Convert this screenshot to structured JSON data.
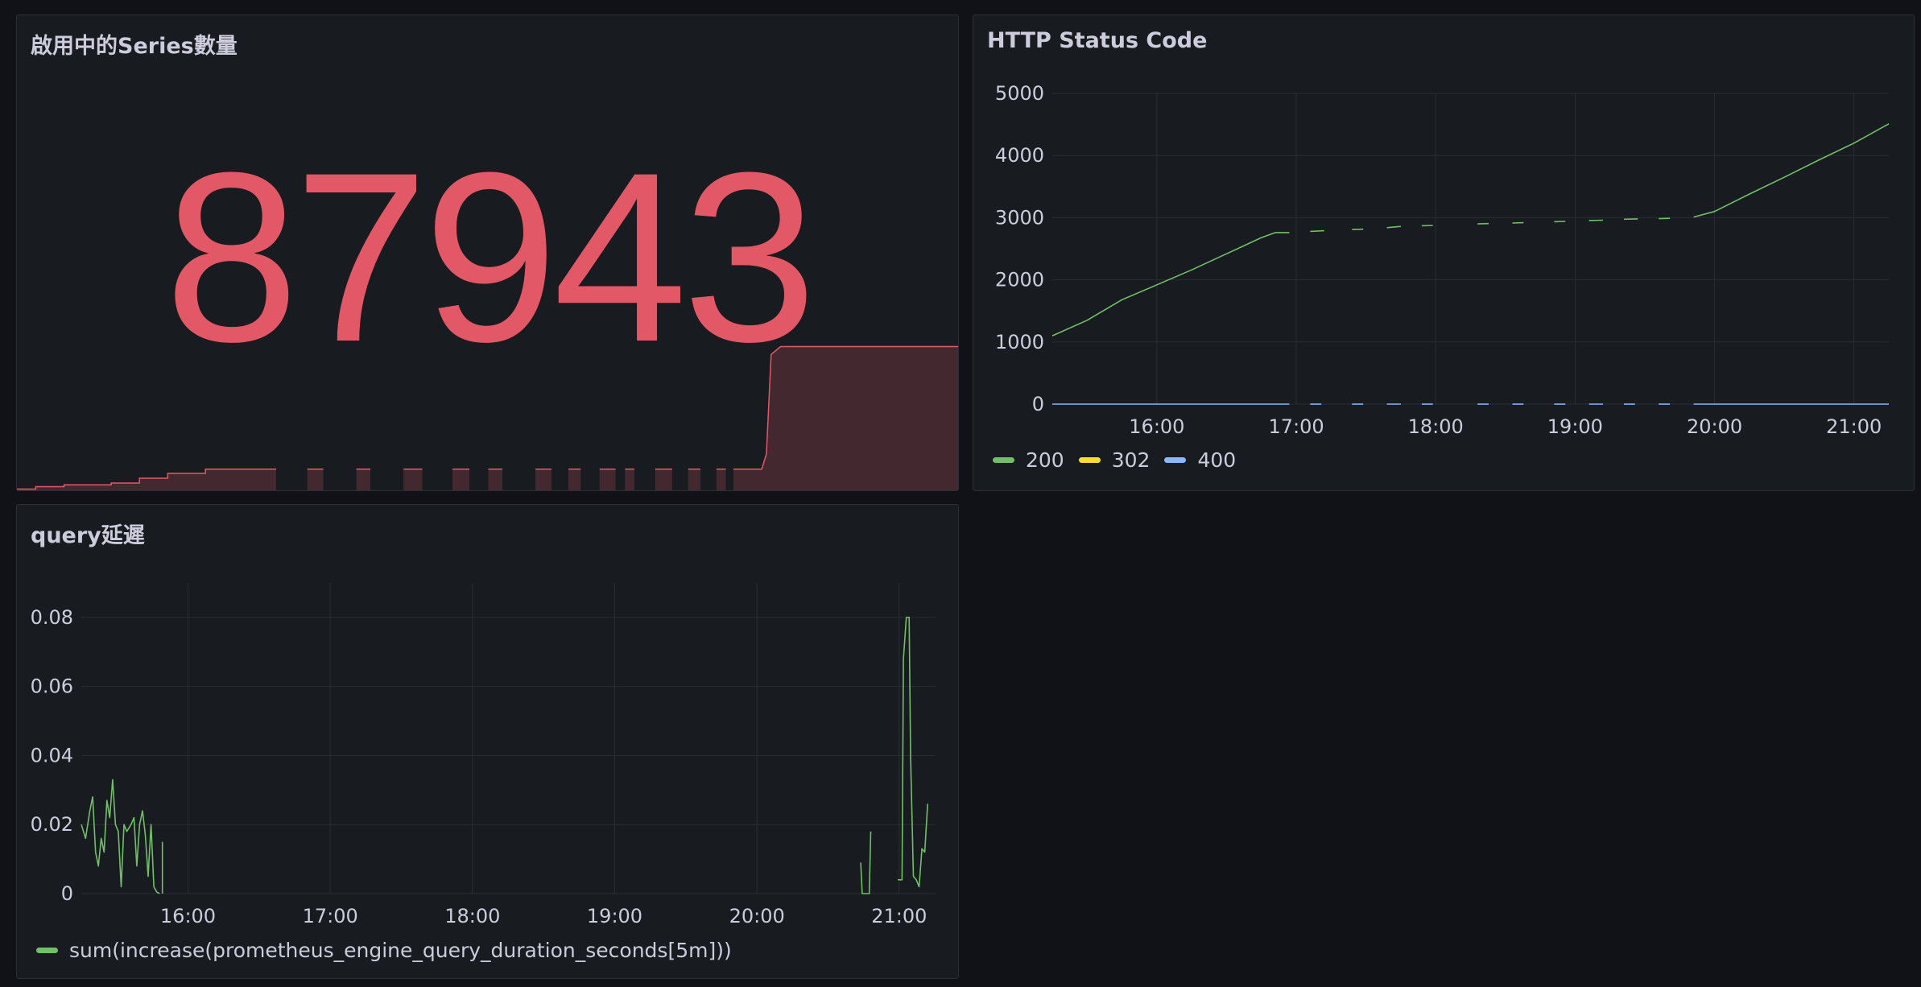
{
  "panels": {
    "series": {
      "title": "啟用中的Series數量",
      "value": "87943",
      "color": "#e35867",
      "sparkline": [
        [
          0,
          0.02
        ],
        [
          0.02,
          0.02
        ],
        [
          0.02,
          0.06
        ],
        [
          0.05,
          0.06
        ],
        [
          0.05,
          0.09
        ],
        [
          0.1,
          0.09
        ],
        [
          0.1,
          0.12
        ],
        [
          0.13,
          0.12
        ],
        [
          0.13,
          0.2
        ],
        [
          0.16,
          0.2
        ],
        [
          0.16,
          0.28
        ],
        [
          0.2,
          0.28
        ],
        [
          0.2,
          0.35
        ],
        [
          0.27,
          0.35
        ],
        [
          0.315,
          0.35
        ],
        [
          0.315,
          0.35
        ],
        [
          0.772,
          0.35
        ],
        [
          0.79,
          0.35
        ],
        [
          0.795,
          0.6
        ],
        [
          0.8,
          2.25
        ],
        [
          0.81,
          2.38
        ],
        [
          1,
          2.38
        ]
      ],
      "sparkline_gaps": [
        [
          0.275,
          0.308
        ],
        [
          0.325,
          0.36
        ],
        [
          0.375,
          0.41
        ],
        [
          0.43,
          0.462
        ],
        [
          0.48,
          0.5
        ],
        [
          0.515,
          0.55
        ],
        [
          0.567,
          0.585
        ],
        [
          0.598,
          0.618
        ],
        [
          0.635,
          0.645
        ],
        [
          0.655,
          0.677
        ],
        [
          0.695,
          0.712
        ],
        [
          0.725,
          0.742
        ],
        [
          0.752,
          0.76
        ]
      ]
    },
    "http": {
      "title": "HTTP Status Code",
      "chart_data": {
        "type": "line",
        "x_axis": {
          "ticks": [
            "16:00",
            "17:00",
            "18:00",
            "19:00",
            "20:00",
            "21:00"
          ],
          "tick_positions_hours": [
            16,
            17,
            18,
            19,
            20,
            21
          ],
          "range_hours": [
            15.25,
            21.25
          ]
        },
        "y_axis": {
          "ticks": [
            "0",
            "1000",
            "2000",
            "3000",
            "4000",
            "5000"
          ],
          "ylim": [
            0,
            5000
          ]
        },
        "series": [
          {
            "name": "200",
            "color": "#73bf69",
            "segments": [
              [
                [
                  15.25,
                  1100
                ],
                [
                  15.5,
                  1350
                ],
                [
                  15.75,
                  1680
                ],
                [
                  16.0,
                  1920
                ],
                [
                  16.25,
                  2160
                ],
                [
                  16.5,
                  2420
                ],
                [
                  16.75,
                  2680
                ],
                [
                  16.85,
                  2760
                ],
                [
                  16.95,
                  2760
                ]
              ],
              [
                [
                  17.1,
                  2780
                ],
                [
                  17.2,
                  2790
                ]
              ],
              [
                [
                  17.4,
                  2810
                ],
                [
                  17.48,
                  2815
                ]
              ],
              [
                [
                  17.65,
                  2840
                ],
                [
                  17.75,
                  2860
                ]
              ],
              [
                [
                  17.9,
                  2870
                ],
                [
                  17.98,
                  2875
                ]
              ],
              [
                [
                  18.3,
                  2900
                ],
                [
                  18.38,
                  2905
                ]
              ],
              [
                [
                  18.55,
                  2915
                ],
                [
                  18.63,
                  2920
                ]
              ],
              [
                [
                  18.85,
                  2935
                ],
                [
                  18.93,
                  2940
                ]
              ],
              [
                [
                  19.1,
                  2955
                ],
                [
                  19.2,
                  2960
                ]
              ],
              [
                [
                  19.35,
                  2975
                ],
                [
                  19.45,
                  2980
                ]
              ],
              [
                [
                  19.6,
                  2985
                ],
                [
                  19.68,
                  2990
                ]
              ],
              [
                [
                  19.85,
                  3010
                ],
                [
                  20.0,
                  3100
                ],
                [
                  20.25,
                  3380
                ],
                [
                  20.5,
                  3650
                ],
                [
                  20.75,
                  3930
                ],
                [
                  21.0,
                  4200
                ],
                [
                  21.25,
                  4510
                ]
              ]
            ]
          },
          {
            "name": "302",
            "color": "#fade2a",
            "segments": []
          },
          {
            "name": "400",
            "color": "#8ab8ff",
            "segments": [
              [
                [
                  15.25,
                  0
                ],
                [
                  16.95,
                  0
                ]
              ],
              [
                [
                  17.1,
                  0
                ],
                [
                  17.18,
                  0
                ]
              ],
              [
                [
                  17.4,
                  0
                ],
                [
                  17.48,
                  0
                ]
              ],
              [
                [
                  17.65,
                  0
                ],
                [
                  17.75,
                  0
                ]
              ],
              [
                [
                  17.9,
                  0
                ],
                [
                  17.98,
                  0
                ]
              ],
              [
                [
                  18.3,
                  0
                ],
                [
                  18.38,
                  0
                ]
              ],
              [
                [
                  18.55,
                  0
                ],
                [
                  18.63,
                  0
                ]
              ],
              [
                [
                  18.85,
                  0
                ],
                [
                  18.93,
                  0
                ]
              ],
              [
                [
                  19.1,
                  0
                ],
                [
                  19.2,
                  0
                ]
              ],
              [
                [
                  19.35,
                  0
                ],
                [
                  19.43,
                  0
                ]
              ],
              [
                [
                  19.6,
                  0
                ],
                [
                  19.68,
                  0
                ]
              ],
              [
                [
                  19.85,
                  0
                ],
                [
                  21.25,
                  0
                ]
              ]
            ]
          }
        ]
      }
    },
    "query": {
      "title": "query延遲",
      "chart_data": {
        "type": "line",
        "x_axis": {
          "ticks": [
            "16:00",
            "17:00",
            "18:00",
            "19:00",
            "20:00",
            "21:00"
          ],
          "tick_positions_hours": [
            16,
            17,
            18,
            19,
            20,
            21
          ],
          "range_hours": [
            15.25,
            21.25
          ]
        },
        "y_axis": {
          "ticks": [
            "0",
            "0.02",
            "0.04",
            "0.06",
            "0.08"
          ],
          "ylim": [
            0,
            0.09
          ]
        },
        "series": [
          {
            "name": "sum(increase(prometheus_engine_query_duration_seconds[5m]))",
            "color": "#73bf69",
            "segments": [
              [
                [
                  15.25,
                  0.02
                ],
                [
                  15.28,
                  0.016
                ],
                [
                  15.31,
                  0.024
                ],
                [
                  15.33,
                  0.028
                ],
                [
                  15.35,
                  0.012
                ],
                [
                  15.37,
                  0.008
                ],
                [
                  15.39,
                  0.016
                ],
                [
                  15.41,
                  0.012
                ],
                [
                  15.43,
                  0.027
                ],
                [
                  15.45,
                  0.022
                ],
                [
                  15.47,
                  0.033
                ],
                [
                  15.49,
                  0.02
                ],
                [
                  15.51,
                  0.018
                ],
                [
                  15.53,
                  0.002
                ],
                [
                  15.55,
                  0.02
                ],
                [
                  15.57,
                  0.018
                ],
                [
                  15.6,
                  0.02
                ],
                [
                  15.62,
                  0.022
                ],
                [
                  15.64,
                  0.008
                ],
                [
                  15.66,
                  0.02
                ],
                [
                  15.68,
                  0.024
                ],
                [
                  15.7,
                  0.017
                ],
                [
                  15.72,
                  0.005
                ],
                [
                  15.74,
                  0.02
                ],
                [
                  15.76,
                  0.002
                ],
                [
                  15.78,
                  0.0005
                ],
                [
                  15.8,
                  0.0
                ],
                [
                  15.8,
                  0.0
                ]
              ],
              [
                [
                  15.82,
                  0.0
                ],
                [
                  15.82,
                  0.015
                ]
              ],
              [
                [
                  20.73,
                  0.009
                ],
                [
                  20.74,
                  0.0
                ],
                [
                  20.79,
                  0.0
                ],
                [
                  20.8,
                  0.018
                ]
              ],
              [
                [
                  20.99,
                  0.004
                ],
                [
                  21.02,
                  0.004
                ],
                [
                  21.03,
                  0.068
                ],
                [
                  21.05,
                  0.08
                ],
                [
                  21.07,
                  0.08
                ],
                [
                  21.08,
                  0.04
                ],
                [
                  21.1,
                  0.005
                ],
                [
                  21.12,
                  0.004
                ],
                [
                  21.14,
                  0.002
                ],
                [
                  21.16,
                  0.013
                ],
                [
                  21.18,
                  0.012
                ],
                [
                  21.2,
                  0.026
                ]
              ]
            ]
          }
        ]
      }
    }
  }
}
